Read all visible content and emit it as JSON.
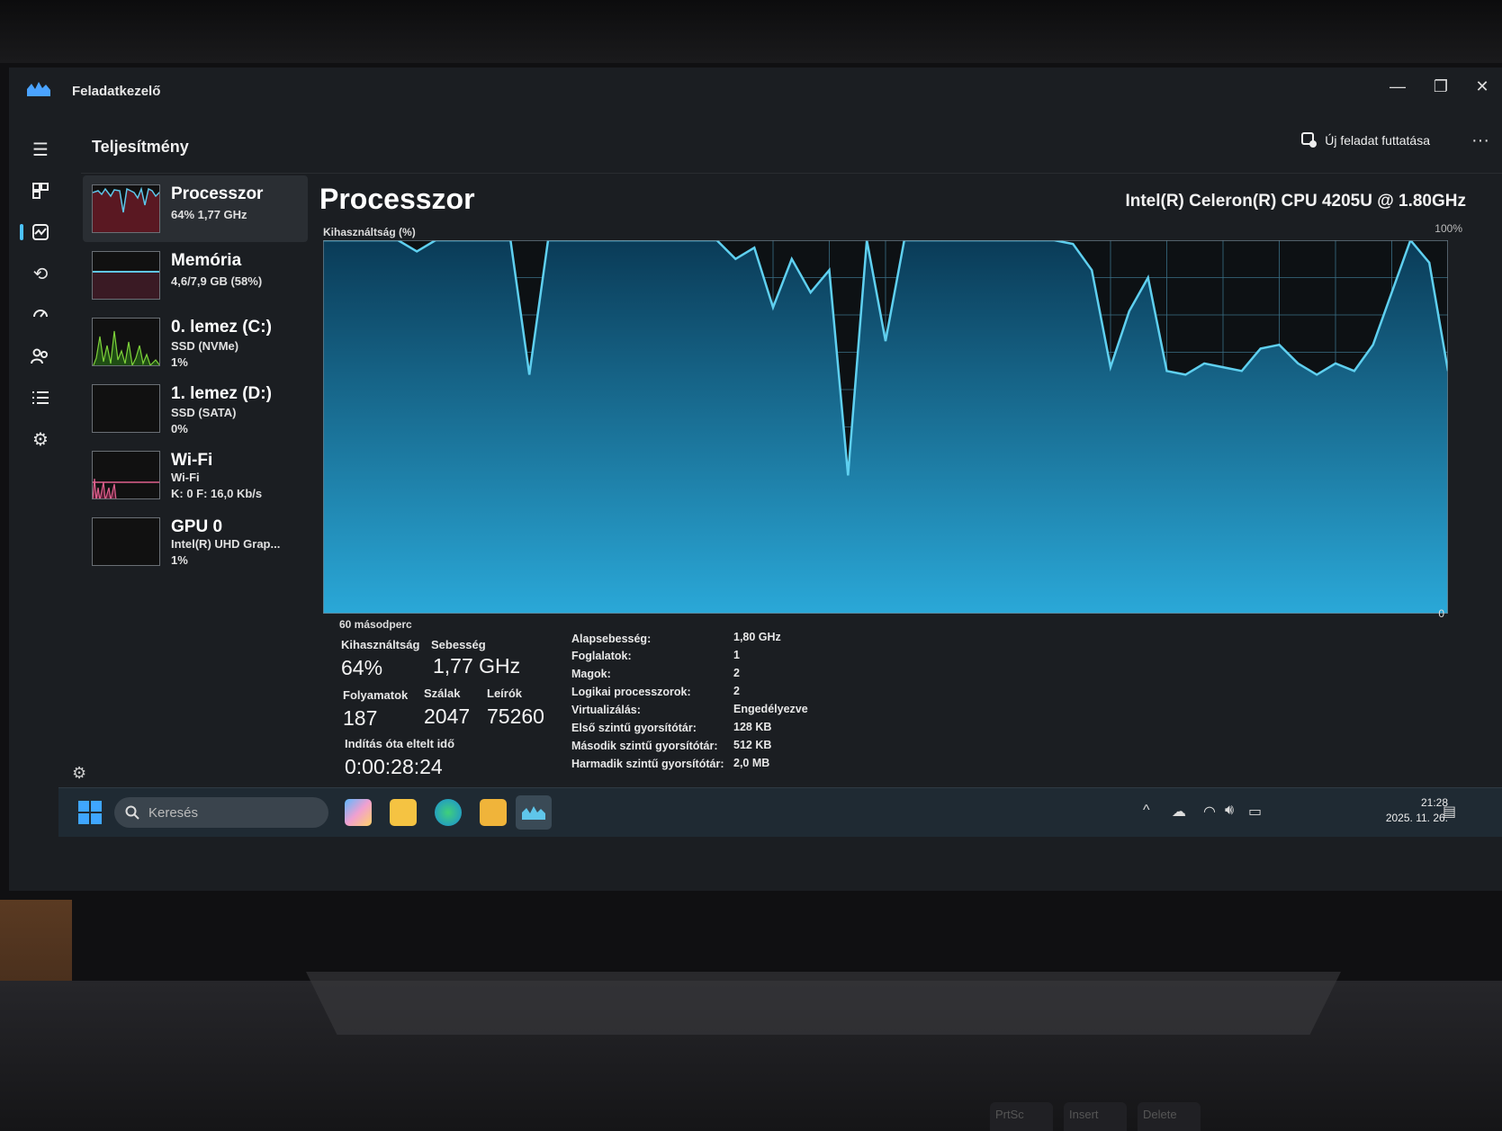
{
  "window": {
    "app_title": "Feladatkezelő",
    "minimize": "—",
    "maximize": "❐",
    "close": "✕"
  },
  "header": {
    "section_title": "Teljesítmény",
    "run_task_label": "Új feladat futtatása",
    "more_label": "···"
  },
  "nav_icons": [
    "hamburger-icon",
    "processes-icon",
    "performance-icon",
    "app-history-icon",
    "startup-icon",
    "users-icon",
    "details-icon",
    "services-icon"
  ],
  "sidebar": {
    "items": [
      {
        "name": "Processzor",
        "sub1": "64% 1,77 GHz",
        "sub2": "",
        "sub3": ""
      },
      {
        "name": "Memória",
        "sub1": "4,6/7,9 GB (58%)",
        "sub2": "",
        "sub3": ""
      },
      {
        "name": "0. lemez (C:)",
        "sub1": "SSD (NVMe)",
        "sub2": "1%",
        "sub3": ""
      },
      {
        "name": "1. lemez (D:)",
        "sub1": "SSD (SATA)",
        "sub2": "0%",
        "sub3": ""
      },
      {
        "name": "Wi-Fi",
        "sub1": "Wi-Fi",
        "sub2": "K: 0 F: 16,0 Kb/s",
        "sub3": ""
      },
      {
        "name": "GPU 0",
        "sub1": "Intel(R) UHD Grap...",
        "sub2": "1%",
        "sub3": ""
      }
    ]
  },
  "main": {
    "title": "Processzor",
    "model": "Intel(R) Celeron(R) CPU 4205U @ 1.80GHz",
    "util_label": "Kihasználtság (%)",
    "max_label": "100%",
    "time_label": "60 másodperc",
    "zero_label": "0"
  },
  "stats": {
    "util_label": "Kihasználtság",
    "util_value": "64%",
    "speed_label": "Sebesség",
    "speed_value": "1,77 GHz",
    "proc_label": "Folyamatok",
    "proc_value": "187",
    "threads_label": "Szálak",
    "threads_value": "2047",
    "handles_label": "Leírók",
    "handles_value": "75260",
    "uptime_label": "Indítás óta eltelt idő",
    "uptime_value": "0:00:28:24"
  },
  "specs": [
    {
      "k": "Alapsebesség:",
      "v": "1,80 GHz"
    },
    {
      "k": "Foglalatok:",
      "v": "1"
    },
    {
      "k": "Magok:",
      "v": "2"
    },
    {
      "k": "Logikai processzorok:",
      "v": "2"
    },
    {
      "k": "Virtualizálás:",
      "v": "Engedélyezve"
    },
    {
      "k": "Első szintű gyorsítótár:",
      "v": "128 KB"
    },
    {
      "k": "Második szintű gyorsítótár:",
      "v": "512 KB"
    },
    {
      "k": "Harmadik szintű gyorsítótár:",
      "v": "2,0 MB"
    }
  ],
  "chart_data": {
    "type": "area",
    "title": "Processzor",
    "ylabel": "Kihasználtság (%)",
    "xlabel": "60 másodperc",
    "ylim": [
      0,
      100
    ],
    "xlim": [
      60,
      0
    ],
    "x": [
      60,
      59,
      58,
      57,
      56,
      55,
      54,
      53,
      52,
      51,
      50,
      49,
      48,
      47,
      46,
      45,
      44,
      43,
      42,
      41,
      40,
      39,
      38,
      37,
      36,
      35,
      34,
      33,
      32,
      31,
      30,
      29,
      28,
      27,
      26,
      25,
      24,
      23,
      22,
      21,
      20,
      19,
      18,
      17,
      16,
      15,
      14,
      13,
      12,
      11,
      10,
      9,
      8,
      7,
      6,
      5,
      4,
      3,
      2,
      1,
      0
    ],
    "series": [
      {
        "values": [
          100,
          100,
          100,
          100,
          100,
          97,
          100,
          100,
          100,
          100,
          100,
          64,
          100,
          100,
          100,
          100,
          100,
          100,
          100,
          100,
          100,
          100,
          95,
          98,
          82,
          95,
          86,
          92,
          37,
          100,
          73,
          100,
          100,
          100,
          100,
          100,
          100,
          100,
          100,
          100,
          99,
          92,
          66,
          81,
          90,
          65,
          64,
          67,
          66,
          65,
          71,
          72,
          67,
          64,
          67,
          65,
          72,
          86,
          100,
          94,
          65
        ]
      }
    ],
    "colors": {
      "line": "#5fd0f0",
      "fill_top": "#0a3b57",
      "fill_bottom": "#2aa8d8",
      "grid": "#3a6f86"
    }
  },
  "taskbar": {
    "search_placeholder": "Keresés",
    "apps": [
      "copilot-icon",
      "file-explorer-icon",
      "edge-icon",
      "store-icon",
      "task-manager-icon"
    ],
    "time": "21:28",
    "date": "2025. 11. 26."
  },
  "keyboard": [
    "PrtSc",
    "Insert",
    "Delete"
  ]
}
